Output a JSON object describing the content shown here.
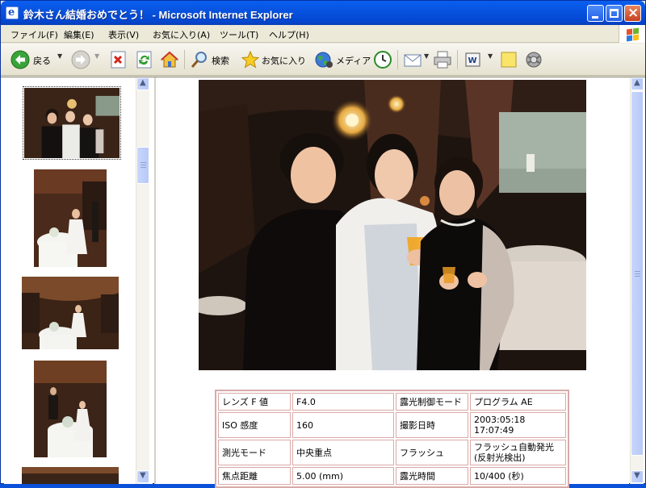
{
  "window": {
    "title": "鈴木さん結婚おめでとう！ - Microsoft Internet Explorer"
  },
  "menu": [
    "ファイル(F)",
    "編集(E)",
    "表示(V)",
    "お気に入り(A)",
    "ツール(T)",
    "ヘルプ(H)"
  ],
  "toolbar": {
    "back_label": "戻る",
    "search_label": "検索",
    "favorites_label": "お気に入り",
    "media_label": "メディア"
  },
  "exif": {
    "rows": [
      {
        "k1": "レンズ F 値",
        "v1": "F4.0",
        "k2": "露光制御モード",
        "v2": "プログラム AE"
      },
      {
        "k1": "ISO 感度",
        "v1": "160",
        "k2": "撮影日時",
        "v2": "2003:05:18 17:07:49"
      },
      {
        "k1": "測光モード",
        "v1": "中央重点",
        "k2": "フラッシュ",
        "v2": "フラッシュ自動発光(反射光検出)"
      },
      {
        "k1": "焦点距離",
        "v1": "5.00 (mm)",
        "k2": "露光時間",
        "v2": "10/400 (秒)"
      }
    ]
  },
  "colors": {
    "title_bar": "#0754e0",
    "table_border": "#d8aaa8",
    "chrome": "#ece9d8"
  }
}
